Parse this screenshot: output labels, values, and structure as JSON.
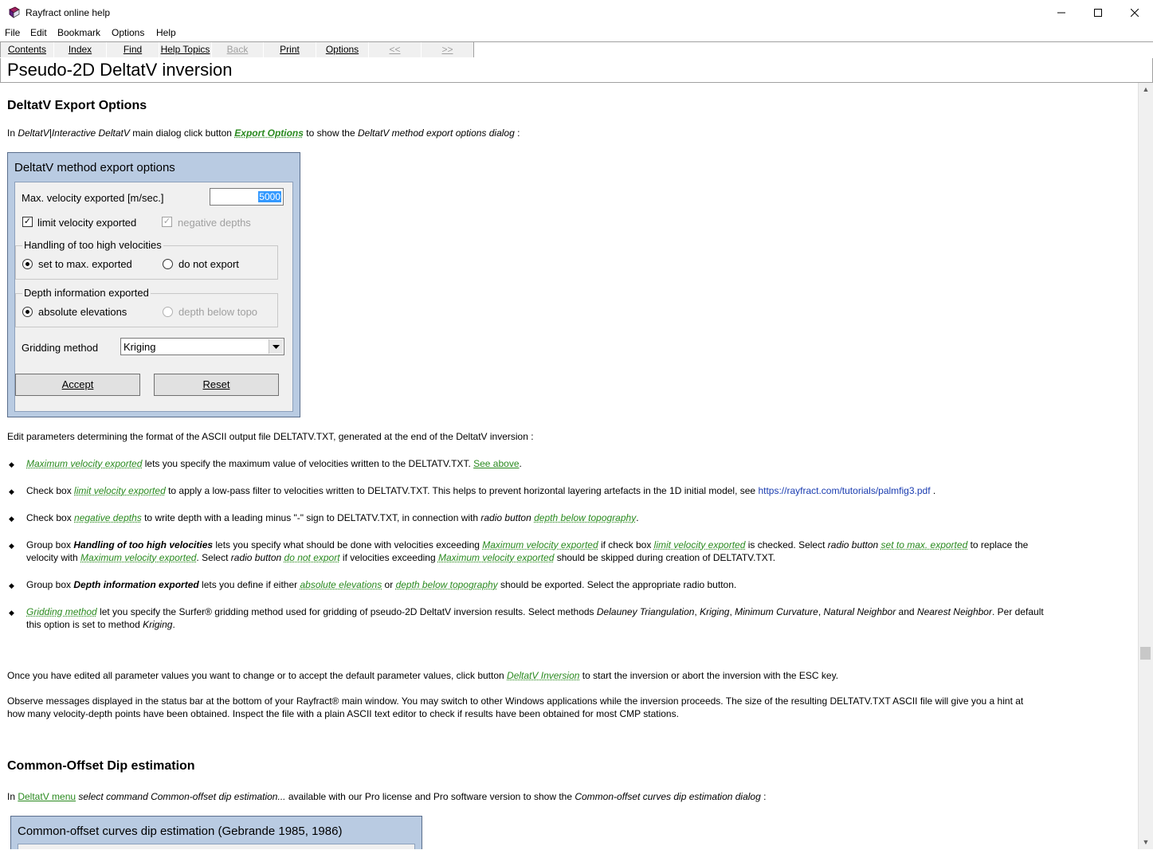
{
  "window": {
    "title": "Rayfract online help"
  },
  "menu": [
    "File",
    "Edit",
    "Bookmark",
    "Options",
    "Help"
  ],
  "toolbar": [
    {
      "label": "Contents",
      "disabled": false
    },
    {
      "label": "Index",
      "disabled": false
    },
    {
      "label": "Find",
      "disabled": false
    },
    {
      "label": "Help Topics",
      "disabled": false
    },
    {
      "label": "Back",
      "disabled": true
    },
    {
      "label": "Print",
      "disabled": false
    },
    {
      "label": "Options",
      "disabled": false
    },
    {
      "label": "<<",
      "disabled": true
    },
    {
      "label": ">>",
      "disabled": true
    }
  ],
  "topic_title": "Pseudo-2D DeltatV inversion",
  "sec1": {
    "heading": "DeltatV Export Options",
    "intro": {
      "a": "In ",
      "b": "DeltatV|Interactive DeltatV",
      "c": " main dialog click button ",
      "link": "Export Options",
      "d": " to show the ",
      "e": "DeltatV method export options dialog",
      "f": " :"
    }
  },
  "dialog1": {
    "title": "DeltatV method export options",
    "max_vel_label": "Max. velocity exported [m/sec.]",
    "max_vel_value": "5000",
    "limit_label": "limit velocity exported",
    "neg_label": "negative depths",
    "group1": {
      "label": "Handling of too high velocities",
      "opt1": "set to max. exported",
      "opt2": "do not export"
    },
    "group2": {
      "label": "Depth information exported",
      "opt1": "absolute elevations",
      "opt2": "depth below topo"
    },
    "grid_label": "Gridding method",
    "grid_value": "Kriging",
    "accept": "Accept",
    "reset": "Reset"
  },
  "edit_params": "Edit parameters determining the format of the ASCII output file DELTATV.TXT, generated at the end of the DeltatV inversion :",
  "b1": {
    "link": "Maximum velocity exported",
    "t": " lets you specify the maximum value of velocities written to the DELTATV.TXT. ",
    "see": "See above",
    "end": "."
  },
  "b2": {
    "a": "Check box ",
    "link": "limit velocity exported",
    "t": " to apply a low-pass filter to velocities written to DELTATV.TXT. This helps to prevent horizontal layering artefacts in the 1D initial model, see ",
    "url": "https://rayfract.com/tutorials/palmfig3.pdf",
    "end": " ."
  },
  "b3": {
    "a": "Check box ",
    "link": "negative depths",
    "t": " to write depth with a leading minus \"-\" sign to DELTATV.TXT, in connection with ",
    "i": "radio button",
    "sp": " ",
    "link2": "depth below topography",
    "end": "."
  },
  "b4": {
    "a": "Group box ",
    "bold": "Handling of too high velocities",
    "t1": " lets you specify what should be done with velocities exceeding ",
    "l1": "Maximum velocity exported",
    "t2": " if check box ",
    "l2": "limit velocity exported",
    "t3": " is checked. Select ",
    "i1": "radio button",
    "sp": " ",
    "l3": "set to max. exported",
    "t4": " to replace the",
    "line2a": "velocity with ",
    "l4": "Maximum velocity exported",
    "t5": ". Select ",
    "i2": "radio button",
    "l5": "do not export",
    "t6": " if velocities exceeding ",
    "l6": "Maximum velocity exported",
    "t7": " should be skipped during creation of DELTATV.TXT."
  },
  "b5": {
    "a": "Group box ",
    "bold": "Depth information exported",
    "t1": " lets you define if either ",
    "l1": "absolute elevations",
    "t2": " or ",
    "l2": "depth below topography",
    "t3": " should be exported. Select the appropriate radio button."
  },
  "b6": {
    "link": "Gridding method",
    "t1": " let you specify the Surfer® gridding method used for gridding of pseudo-2D DeltatV inversion results. Select methods ",
    "i1": "Delauney Triangulation",
    "c1": ", ",
    "i2": "Kriging",
    "c2": ", ",
    "i3": "Minimum Curvature",
    "c3": ", ",
    "i4": "Natural Neighbor",
    "and": " and ",
    "i5": "Nearest Neighbor",
    "t2": ". Per default",
    "line2": "this option is set to method ",
    "i6": "Kriging",
    "end": "."
  },
  "once": {
    "a": "Once you have edited all parameter values you want to change or to accept the default parameter values, click button ",
    "link": "DeltatV Inversion",
    "b": " to start the inversion or abort the inversion with the ESC key."
  },
  "observe": {
    "line1": "Observe messages displayed in the status bar at the bottom of your Rayfract® main window. You may switch to other Windows applications while the inversion proceeds. The size of the resulting DELTATV.TXT ASCII file will give you a hint at",
    "line2": "how many velocity-depth points have been obtained. Inspect the file with a plain ASCII text editor to check if results have been obtained for most CMP stations."
  },
  "sec2": {
    "heading": "Common-Offset Dip estimation",
    "intro": {
      "a": "In ",
      "link": "DeltatV menu",
      "b": " select command Common-offset dip estimation...",
      "c": " available with our Pro license and Pro software version to show the ",
      "d": "Common-offset curves dip estimation dialog",
      "e": " :"
    }
  },
  "dialog2": {
    "title": "Common-offset curves dip estimation (Gebrande 1985, 1986)"
  }
}
